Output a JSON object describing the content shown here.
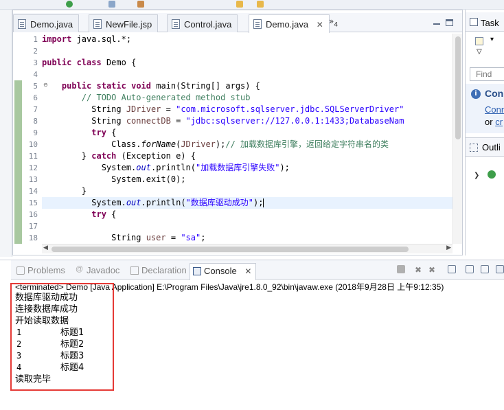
{
  "editor": {
    "tabs": [
      {
        "label": "Demo.java",
        "active": false
      },
      {
        "label": "NewFile.jsp",
        "active": false
      },
      {
        "label": "Control.java",
        "active": false
      },
      {
        "label": "Demo.java",
        "active": true
      }
    ],
    "overflow_count": "4",
    "line_numbers": [
      "1",
      "2",
      "3",
      "4",
      "5",
      "6",
      "7",
      "8",
      "9",
      "10",
      "11",
      "12",
      "13",
      "14",
      "15",
      "16",
      "17",
      "18"
    ],
    "current_line": 15,
    "code": {
      "l1_kw": "import",
      "l1_rest": " java.sql.*;",
      "l3_kw1": "public",
      "l3_kw2": "class",
      "l3_rest": " Demo {",
      "l5_kw1": "public",
      "l5_kw2": "static",
      "l5_kw3": "void",
      "l5_rest": " main(String[] args) {",
      "l6_comment": "// TODO Auto-generated method stub",
      "l7_type": "String ",
      "l7_var": "JDriver",
      "l7_eq": " = ",
      "l7_str": "\"com.microsoft.sqlserver.jdbc.SQLServerDriver\"",
      "l8_type": "String ",
      "l8_var": "connectDB",
      "l8_eq": " = ",
      "l8_str": "\"jdbc:sqlserver://127.0.0.1:1433;DatabaseNam",
      "l9_kw": "try",
      "l9_rest": " {",
      "l10_a": "Class.",
      "l10_m": "forName",
      "l10_b": "(",
      "l10_var": "JDriver",
      "l10_c": ");",
      "l10_comment": "// 加载数据库引擎，返回给定字符串名的类",
      "l11_a": "} ",
      "l11_kw": "catch",
      "l11_rest": " (Exception e) {",
      "l12_a": "System.",
      "l12_fld": "out",
      "l12_b": ".println(",
      "l12_str": "\"加载数据库引擎失败\"",
      "l12_c": ");",
      "l13_a": "System.exit(0);",
      "l14_a": "}",
      "l15_a": "System.",
      "l15_fld": "out",
      "l15_b": ".println(",
      "l15_str": "\"数据库驱动成功\"",
      "l15_c": ");",
      "l16_kw": "try",
      "l16_rest": " {",
      "l18_type": "String ",
      "l18_var": "user",
      "l18_eq": " = ",
      "l18_str": "\"sa\"",
      "l18_c": ";"
    }
  },
  "right_panel": {
    "task_tab": "Task",
    "find_placeholder": "Find",
    "connect_title": "Con",
    "connect_link": "Conn",
    "connect_or": "or",
    "connect_or_link": "cr",
    "outline_tab": "Outli"
  },
  "console": {
    "tabs": [
      {
        "label": "Problems",
        "active": false
      },
      {
        "label": "Javadoc",
        "active": false
      },
      {
        "label": "Declaration",
        "active": false
      },
      {
        "label": "Console",
        "active": true
      }
    ],
    "status": "<terminated> Demo [Java Application] E:\\Program Files\\Java\\jre1.8.0_92\\bin\\javaw.exe (2018年9月28日 上午9:12:35)",
    "lines": [
      "数据库驱动成功",
      "连接数据库成功",
      "开始读取数据"
    ],
    "rows": [
      {
        "id": "1",
        "title": "标题1"
      },
      {
        "id": "2",
        "title": "标题2"
      },
      {
        "id": "3",
        "title": "标题3"
      },
      {
        "id": "4",
        "title": "标题4"
      }
    ],
    "footer": "读取完毕"
  },
  "colors": {
    "keyword": "#7f0055",
    "string": "#2a00ff",
    "comment": "#3f7f5f",
    "field": "#0000c0",
    "highlight_box": "#e53935"
  }
}
